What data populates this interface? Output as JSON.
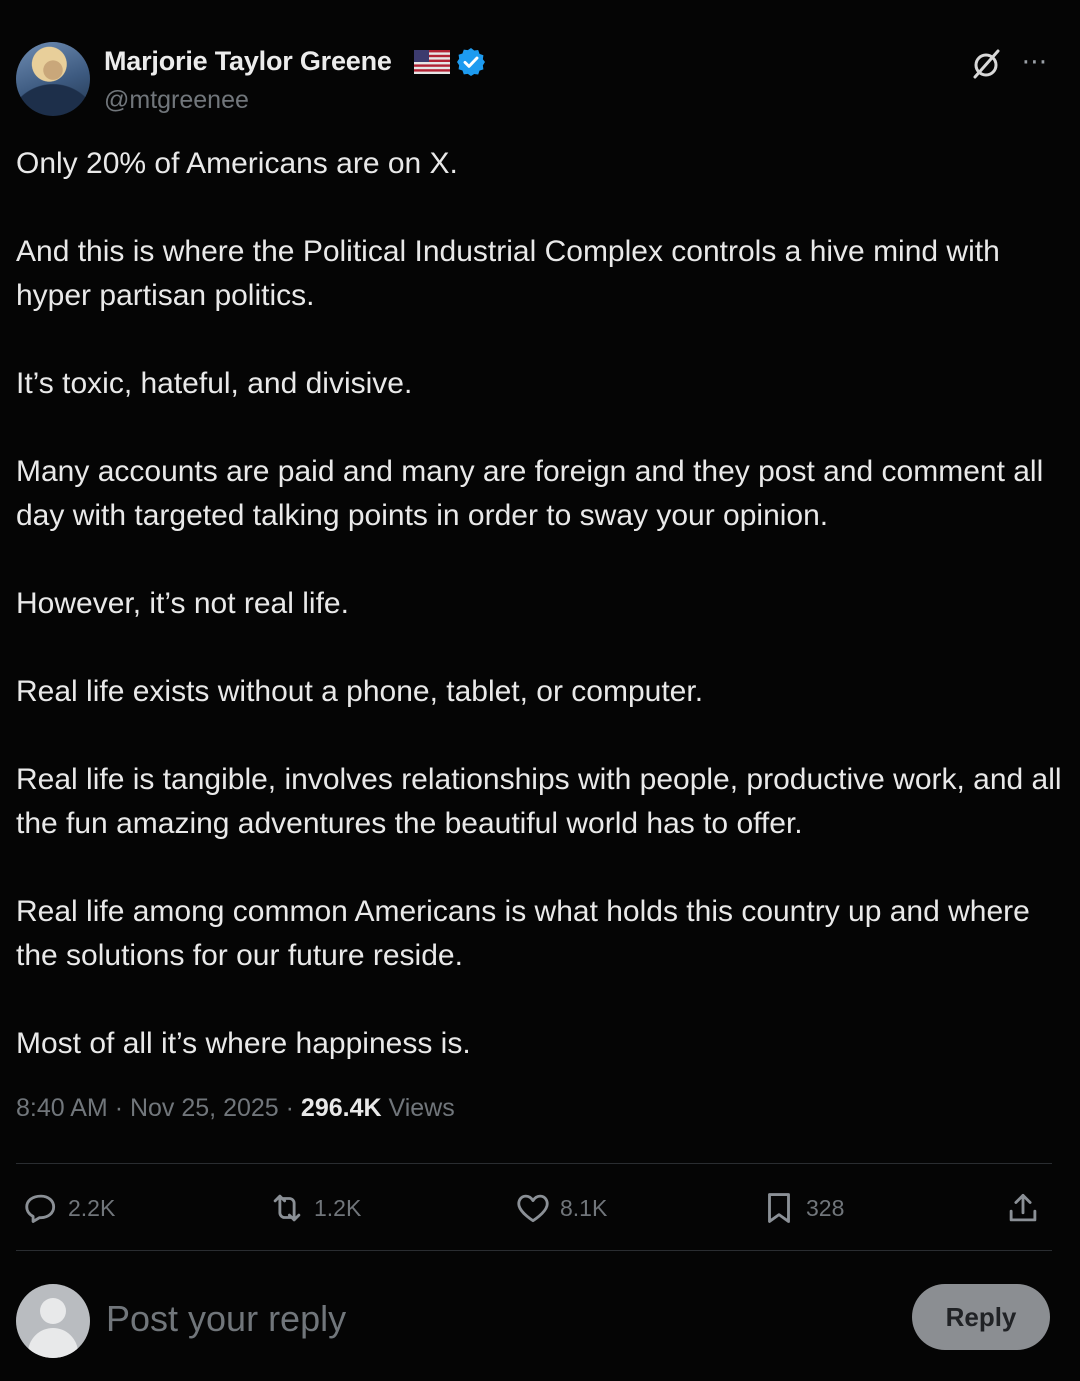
{
  "author": {
    "display_name": "Marjorie Taylor Greene",
    "handle": "@mtgreenee"
  },
  "tweet": {
    "paragraphs": [
      "Only 20% of Americans are on X.",
      "And this is where the Political Industrial Complex controls a hive mind with hyper partisan politics.",
      "It’s toxic, hateful, and divisive.",
      "Many accounts are paid and many are foreign and they post and comment all day with targeted talking points in order to sway your opinion.",
      "However, it’s not real life.",
      "Real life exists without a phone, tablet, or computer.",
      "Real life is tangible, involves relationships with people, productive work, and all the fun amazing adventures the beautiful world has to offer.",
      "Real life among common Americans is what holds this country up and where the solutions for our future reside.",
      "Most of all it’s where happiness is."
    ],
    "time": "8:40 AM",
    "date": "Nov 25, 2025",
    "views_count": "296.4K",
    "views_label": "Views"
  },
  "actions": {
    "replies": "2.2K",
    "reposts": "1.2K",
    "likes": "8.1K",
    "bookmarks": "328"
  },
  "reply_box": {
    "placeholder": "Post your reply",
    "button_label": "Reply"
  },
  "icons": {
    "verified": "verified-badge-icon",
    "flag": "us-flag-icon",
    "grok": "grok-icon",
    "more": "more-icon",
    "reply": "reply-icon",
    "repost": "repost-icon",
    "like": "heart-icon",
    "bookmark": "bookmark-icon",
    "share": "share-icon"
  },
  "colors": {
    "background": "#050505",
    "text": "#e9e9e9",
    "muted": "#71767b",
    "verified": "#1d9bf0",
    "reply_button_bg": "#8b8e92"
  }
}
